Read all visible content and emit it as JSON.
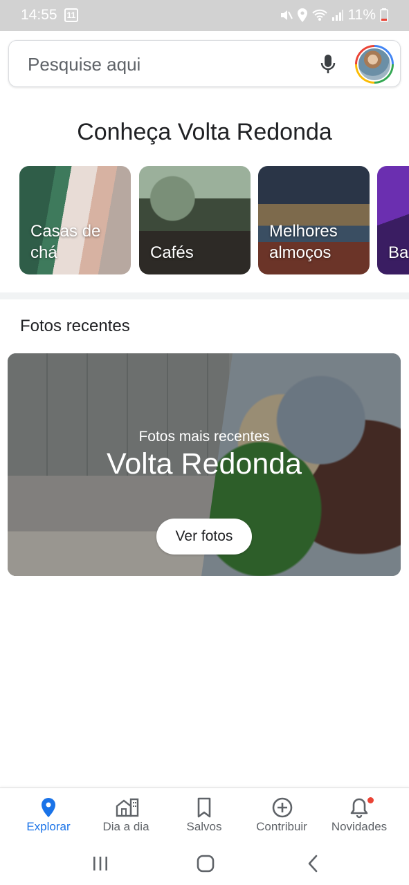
{
  "status_bar": {
    "time": "14:55",
    "badge": "11",
    "battery": "11%",
    "icons": [
      "mute-icon",
      "location-icon",
      "wifi-icon",
      "signal-icon",
      "battery-icon"
    ]
  },
  "search": {
    "placeholder": "Pesquise aqui",
    "icons": [
      "mic-icon",
      "avatar"
    ]
  },
  "discover": {
    "title": "Conheça Volta Redonda",
    "cards": [
      {
        "label": "Casas de chá"
      },
      {
        "label": "Cafés"
      },
      {
        "label": "Melhores almoços"
      },
      {
        "label": "Ba"
      }
    ]
  },
  "recent_photos": {
    "section_title": "Fotos recentes",
    "subtitle": "Fotos mais recentes",
    "title": "Volta Redonda",
    "button": "Ver fotos"
  },
  "bottom_nav": {
    "items": [
      {
        "label": "Explorar",
        "icon": "explore-pin-icon",
        "active": true
      },
      {
        "label": "Dia a dia",
        "icon": "commute-icon",
        "active": false
      },
      {
        "label": "Salvos",
        "icon": "bookmark-icon",
        "active": false
      },
      {
        "label": "Contribuir",
        "icon": "add-circle-icon",
        "active": false
      },
      {
        "label": "Novidades",
        "icon": "bell-icon",
        "active": false
      }
    ],
    "accent": "#1a73e8",
    "notification_dot": "#ea4335"
  },
  "system_nav": [
    "recent-apps-icon",
    "home-icon",
    "back-icon"
  ]
}
